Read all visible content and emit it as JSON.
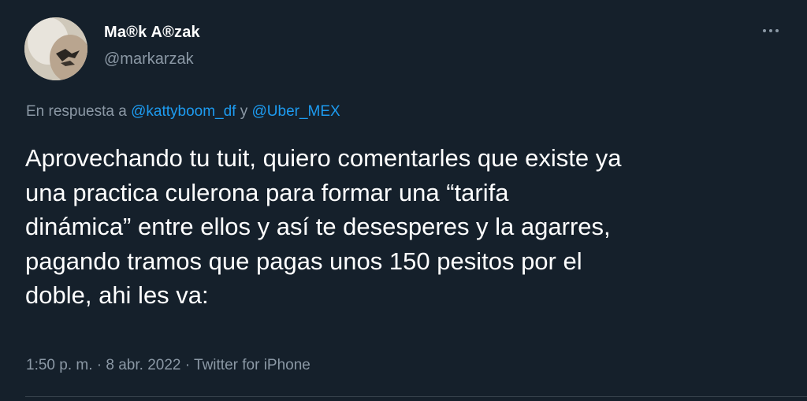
{
  "author": {
    "name": "Ma®k A®zak",
    "handle": "@markarzak",
    "avatar_icon": "avatar-photo"
  },
  "more_icon": "more-options-icon",
  "reply": {
    "prefix": "En respuesta a ",
    "mention_1": "@kattyboom_df",
    "conjunction": " y ",
    "mention_2": "@Uber_MEX"
  },
  "tweet_text": "Aprovechando tu tuit, quiero comentarles que existe ya\nuna practica culerona para formar una “tarifa\ndinámica” entre ellos y así te desesperes y la agarres,\npagando tramos que pagas unos 150 pesitos por el\ndoble, ahi les va:",
  "meta": {
    "time": "1:50 p. m.",
    "sep_1": " · ",
    "date": "8 abr. 2022",
    "sep_2": " · ",
    "source": "Twitter for iPhone"
  },
  "colors": {
    "background": "#15202b",
    "text": "#ffffff",
    "secondary": "#8b98a5",
    "link": "#1d9bf0"
  }
}
